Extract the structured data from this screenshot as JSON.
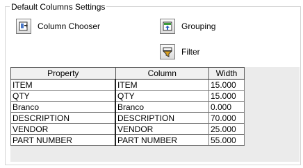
{
  "group": {
    "title": "Default Columns Settings"
  },
  "buttons": {
    "column_chooser": {
      "label": "Column Chooser",
      "icon": "column-chooser-icon"
    },
    "grouping": {
      "label": "Grouping",
      "icon": "grouping-icon"
    },
    "filter": {
      "label": "Filter",
      "icon": "filter-icon"
    }
  },
  "grid": {
    "headers": [
      "Property",
      "Column",
      "Width"
    ],
    "rows": [
      {
        "property": "ITEM",
        "column": "ITEM",
        "width": "15.000"
      },
      {
        "property": "QTY",
        "column": "QTY",
        "width": "15.000"
      },
      {
        "property": "Branco",
        "column": "Branco",
        "width": "0.000"
      },
      {
        "property": "DESCRIPTION",
        "column": "DESCRIPTION",
        "width": "70.000"
      },
      {
        "property": "VENDOR",
        "column": "VENDOR",
        "width": "25.000"
      },
      {
        "property": "PART NUMBER",
        "column": "PART NUMBER",
        "width": "55.000"
      }
    ]
  }
}
